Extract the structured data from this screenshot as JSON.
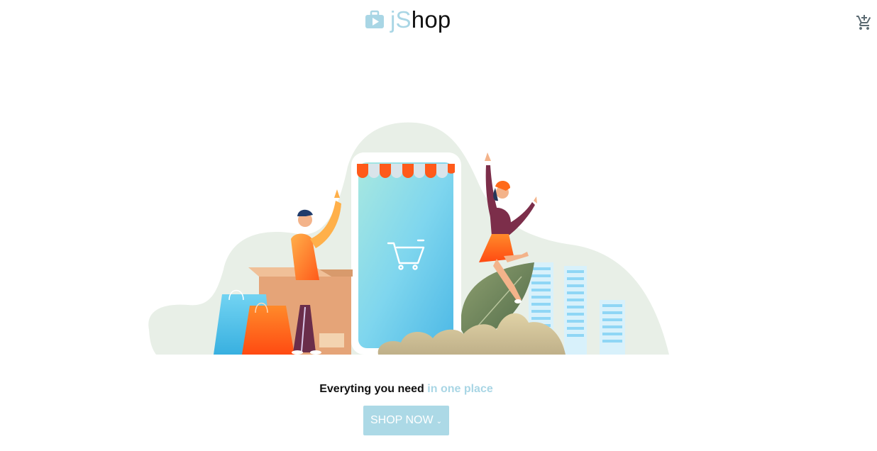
{
  "header": {
    "logo_j": "j",
    "logo_s": "S",
    "logo_rest": "hop",
    "logo_icon": "briefcase-play-icon",
    "cart_icon": "add-shopping-cart-icon"
  },
  "hero": {
    "tagline_main": "Everyting you need",
    "tagline_accent": "in one place",
    "cta_label": "SHOP NOW",
    "cta_chevron": "⌄"
  },
  "colors": {
    "accent": "#a9d6e5",
    "button_bg": "#acd9e6",
    "text_dark": "#111111"
  }
}
